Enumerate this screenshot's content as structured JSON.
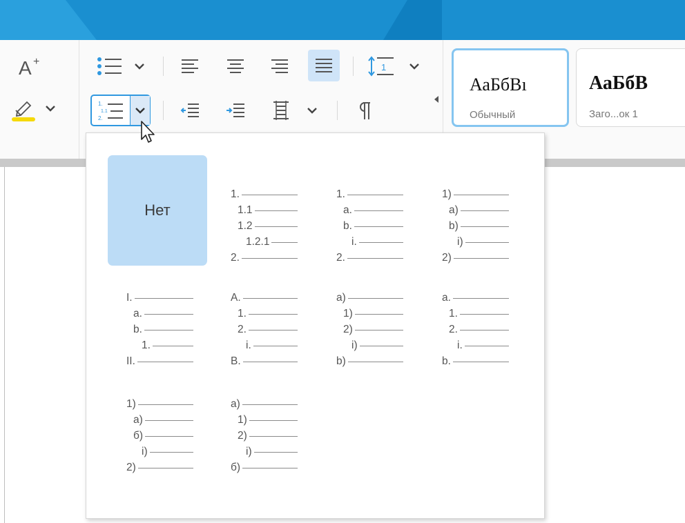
{
  "ribbon": {
    "style_cards": [
      {
        "sample": "АаБбВı",
        "caption": "Обычный"
      },
      {
        "sample": "АаБбВ",
        "caption": "Заго...ок 1"
      }
    ]
  },
  "numbering_menu": {
    "none_label": "Нет",
    "presets": [
      {
        "lines": [
          "1.",
          "1.1",
          "1.2",
          "1.2.1",
          "2."
        ]
      },
      {
        "lines": [
          "1.",
          "a.",
          "b.",
          "i.",
          "2."
        ]
      },
      {
        "lines": [
          "1)",
          "a)",
          "b)",
          "i)",
          "2)"
        ]
      },
      {
        "lines": [
          "I.",
          "a.",
          "b.",
          "1.",
          "II."
        ]
      },
      {
        "lines": [
          "A.",
          "1.",
          "2.",
          "i.",
          "B."
        ]
      },
      {
        "lines": [
          "a)",
          "1)",
          "2)",
          "i)",
          "b)"
        ]
      },
      {
        "lines": [
          "a.",
          "1.",
          "2.",
          "i.",
          "b."
        ]
      },
      {
        "lines": [
          "1)",
          "a)",
          "б)",
          "i)",
          "2)"
        ]
      },
      {
        "lines": [
          "a)",
          "1)",
          "2)",
          "i)",
          "б)"
        ]
      }
    ]
  },
  "colors": {
    "accent": "#1a8fd0",
    "selection": "#bcdcf6",
    "highlight": "#f5d90a"
  }
}
